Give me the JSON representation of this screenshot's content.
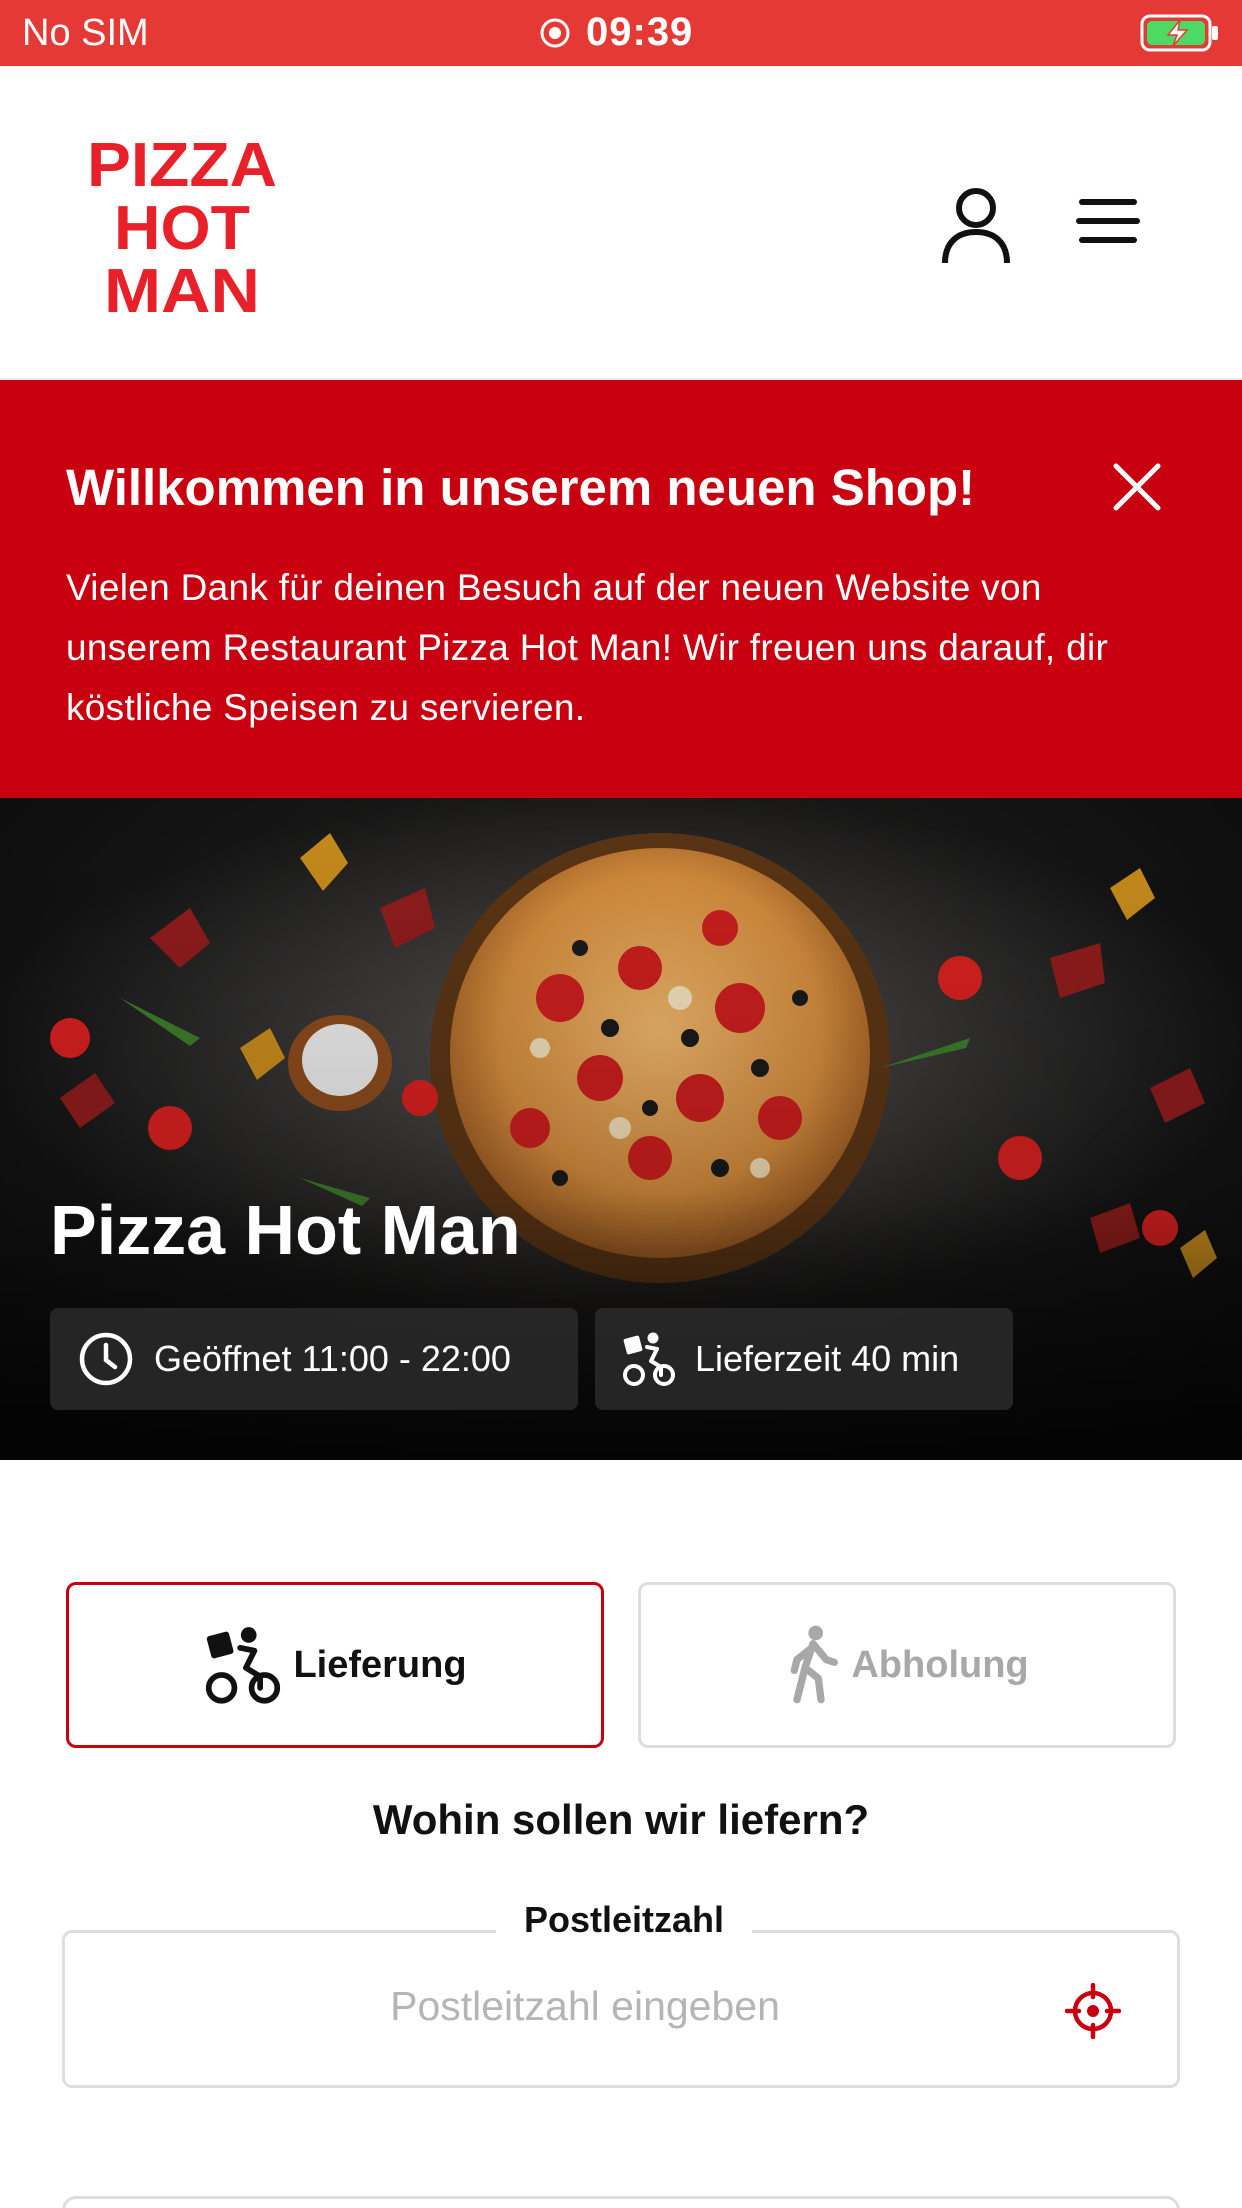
{
  "status_bar": {
    "carrier": "No SIM",
    "time": "09:39"
  },
  "header": {
    "logo_lines": [
      "PIZZA",
      "HOT",
      "MAN"
    ]
  },
  "banner": {
    "title": "Willkommen in unserem neuen Shop!",
    "text": "Vielen Dank für deinen Besuch auf der neuen Website von unserem Restaurant Pizza Hot Man! Wir freuen uns darauf, dir köstliche Speisen zu servieren."
  },
  "hero": {
    "title": "Pizza Hot Man",
    "opening_hours": "Geöffnet 11:00 - 22:00",
    "delivery_time": "Lieferzeit 40 min"
  },
  "order_mode": {
    "delivery_label": "Lieferung",
    "pickup_label": "Abholung",
    "selected": "Lieferung"
  },
  "question": "Wohin sollen wir liefern?",
  "postal": {
    "label": "Postleitzahl",
    "placeholder": "Postleitzahl eingeben",
    "value": ""
  },
  "colors": {
    "status_bar": "#e53935",
    "brand_red": "#c8000f",
    "logo_red": "#e8202a"
  }
}
